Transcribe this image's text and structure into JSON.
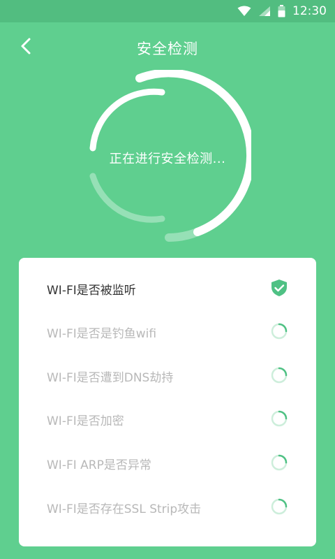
{
  "status_bar": {
    "time": "12:30",
    "icons": [
      "wifi-icon",
      "signal-icon",
      "battery-icon"
    ]
  },
  "header": {
    "title": "安全检测",
    "back_icon": "back-arrow-icon"
  },
  "scan": {
    "status_text": "正在进行安全检测..."
  },
  "checks": [
    {
      "label": "WI-FI是否被监听",
      "state": "done",
      "icon": "shield-check-icon"
    },
    {
      "label": "WI-FI是否是钓鱼wifi",
      "state": "loading",
      "icon": "spinner-icon"
    },
    {
      "label": "WI-FI是否遭到DNS劫持",
      "state": "loading",
      "icon": "spinner-icon"
    },
    {
      "label": "WI-FI是否加密",
      "state": "loading",
      "icon": "spinner-icon"
    },
    {
      "label": "WI-FI ARP是否异常",
      "state": "loading",
      "icon": "spinner-icon"
    },
    {
      "label": "WI-FI是否存在SSL Strip攻击",
      "state": "loading",
      "icon": "spinner-icon"
    }
  ],
  "colors": {
    "background": "#5fcf8f",
    "status_bar": "#52bd80",
    "accent": "#4fc184"
  }
}
